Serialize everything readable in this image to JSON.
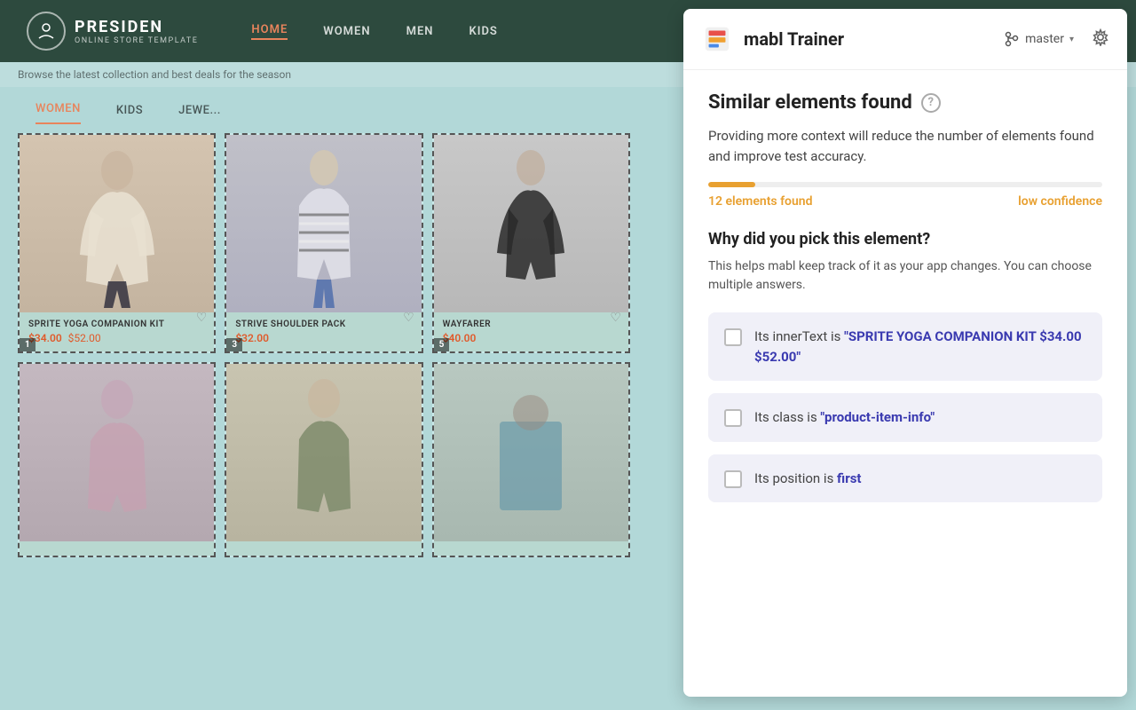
{
  "store": {
    "logo": {
      "brand": "PRESIDEN",
      "tagline": "ONLINE STORE TEMPLATE"
    },
    "marquee_text": "Browse the latest collection and best deals for the season",
    "nav": [
      {
        "label": "HOME",
        "active": true
      },
      {
        "label": "WOMEN",
        "active": false
      },
      {
        "label": "MEN",
        "active": false
      },
      {
        "label": "KIDS",
        "active": false
      }
    ],
    "categories": [
      {
        "label": "WOMEN",
        "active": true
      },
      {
        "label": "KIDS",
        "active": false
      },
      {
        "label": "JEWE...",
        "active": false
      }
    ],
    "products": [
      {
        "title": "SPRITE YOGA COMPANION KIT",
        "sale_price": "$34.00",
        "original_price": "$52.00",
        "badge": "1",
        "highlighted": true
      },
      {
        "title": "STRIVE SHOULDER PACK",
        "sale_price": "$32.00",
        "original_price": "",
        "badge": "3",
        "highlighted": true
      },
      {
        "title": "WAYFARER",
        "sale_price": "$40.00",
        "original_price": "",
        "badge": "5",
        "highlighted": true
      },
      {
        "title": "",
        "sale_price": "",
        "original_price": "",
        "badge": "",
        "highlighted": true
      },
      {
        "title": "",
        "sale_price": "",
        "original_price": "",
        "badge": "",
        "highlighted": true
      },
      {
        "title": "",
        "sale_price": "",
        "original_price": "",
        "badge": "",
        "highlighted": true
      }
    ]
  },
  "mabl": {
    "title": "mabl Trainer",
    "branch_label": "master",
    "section_title": "Similar elements found",
    "description": "Providing more context will reduce the number of elements found and improve test accuracy.",
    "progress_percent": 12,
    "elements_found_label": "12 elements found",
    "confidence_label": "low confidence",
    "why_title": "Why did you pick this element?",
    "why_description": "This helps mabl keep track of it as your app changes. You can choose multiple answers.",
    "choices": [
      {
        "id": "inner-text",
        "label": "Its innerText is ",
        "value": "\"SPRITE YOGA COMPANION KIT $34.00 $52.00\"",
        "checked": false
      },
      {
        "id": "class",
        "label": "Its class is ",
        "value": "\"product-item-info\"",
        "checked": false
      },
      {
        "id": "position",
        "label": "Its position is ",
        "value": "first",
        "checked": false
      }
    ]
  }
}
